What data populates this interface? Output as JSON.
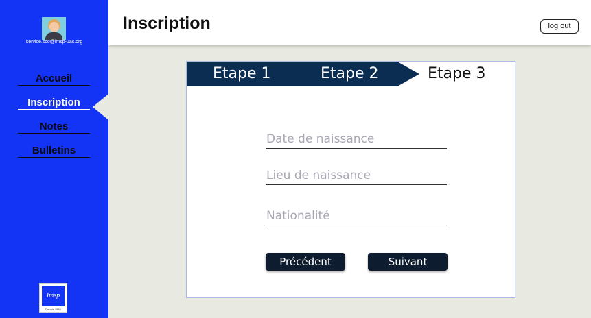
{
  "sidebar": {
    "email": "service.sco@imsp-uac.org",
    "items": [
      {
        "label": "Accueil"
      },
      {
        "label": "Inscription"
      },
      {
        "label": "Notes"
      },
      {
        "label": "Bulletins"
      }
    ],
    "active_item": "Inscription",
    "logo_text": "Imsp",
    "logo_caption": "Depuis 1988",
    "accent_color": "#1434f5"
  },
  "header": {
    "title": "Inscription",
    "logout_label": "log out"
  },
  "wizard": {
    "steps": [
      {
        "label": "Etape 1"
      },
      {
        "label": "Etape 2"
      },
      {
        "label": "Etape 3"
      }
    ],
    "current_step": 3,
    "step_color": "#0c2d52",
    "fields": {
      "birth_date": {
        "placeholder": "Date de naissance",
        "value": ""
      },
      "birth_place": {
        "placeholder": "Lieu de naissance",
        "value": ""
      },
      "nationality": {
        "placeholder": "Nationalité",
        "value": ""
      }
    },
    "buttons": {
      "previous": "Précédent",
      "next": "Suivant"
    }
  }
}
